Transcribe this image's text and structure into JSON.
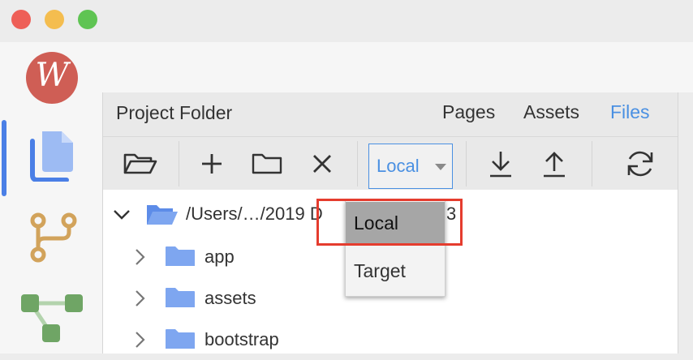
{
  "window": {
    "traffic_lights": {
      "close_color": "#ee5f57",
      "minimize_color": "#f4bd4f",
      "maximize_color": "#5fc453"
    }
  },
  "sidebar": {
    "logo_letter": "W",
    "logo_color": "#cf5e55",
    "items": [
      {
        "icon": "pages-icon",
        "active": true
      },
      {
        "icon": "branch-icon",
        "active": false
      },
      {
        "icon": "tree-icon",
        "active": false
      }
    ],
    "active_color": "#4a7fe6"
  },
  "panel": {
    "title": "Project Folder",
    "tabs": [
      {
        "label": "Pages",
        "active": false
      },
      {
        "label": "Assets",
        "active": false
      },
      {
        "label": "Files",
        "active": true
      }
    ],
    "accent_color": "#4a90e2"
  },
  "toolbar": {
    "buttons": [
      {
        "icon": "open-folder-icon"
      },
      {
        "icon": "plus-icon"
      },
      {
        "icon": "new-folder-icon"
      },
      {
        "icon": "close-icon"
      },
      {
        "icon": "download-icon"
      },
      {
        "icon": "upload-icon"
      },
      {
        "icon": "sync-icon"
      }
    ],
    "location_select": {
      "value": "Local",
      "options": [
        "Local",
        "Target"
      ]
    }
  },
  "tree": {
    "root": {
      "path_visible_left": "/Users/…/2019 D",
      "path_visible_right": "3",
      "expanded": true
    },
    "items": [
      {
        "label": "app"
      },
      {
        "label": "assets"
      },
      {
        "label": "bootstrap"
      }
    ]
  },
  "dropdown": {
    "options": [
      {
        "label": "Local",
        "selected": true
      },
      {
        "label": "Target",
        "selected": false
      }
    ],
    "highlight_color": "#e53c2e"
  }
}
